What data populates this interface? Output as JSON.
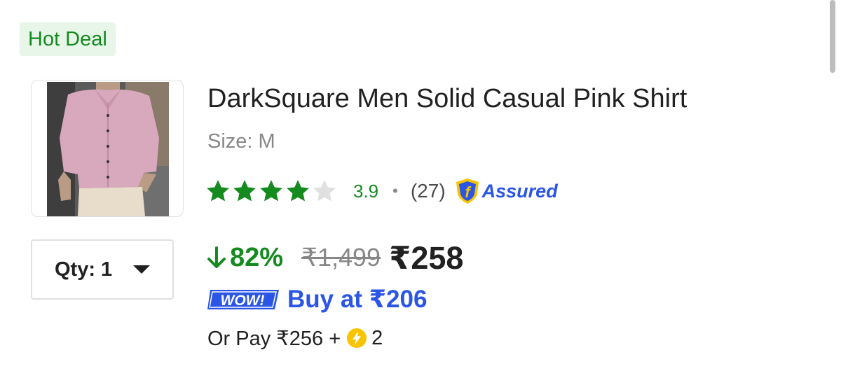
{
  "badge": {
    "label": "Hot Deal"
  },
  "product": {
    "title": "DarkSquare Men Solid Casual Pink Shirt",
    "size": "Size: M",
    "image_alt": "Pink shirt model photo"
  },
  "quantity": {
    "label": "Qty: 1"
  },
  "rating": {
    "value": "3.9",
    "separator": "•",
    "reviews": "(27)",
    "stars_filled": 4,
    "stars_total": 5,
    "assured_label": "Assured"
  },
  "pricing": {
    "discount": "82%",
    "mrp": "₹1,499",
    "price": "₹258"
  },
  "wow": {
    "badge_text": "WOW!",
    "label": "Buy at ₹206"
  },
  "pay": {
    "prefix": "Or Pay ₹256 +",
    "coins": "2"
  },
  "colors": {
    "green": "#148a1f",
    "blue": "#2a55e5",
    "badge_bg": "#e8f5e9",
    "star_empty": "#e0e0e0",
    "coin": "#f8c300"
  },
  "icons": {
    "discount": "arrow-down-icon",
    "quantity": "caret-down-icon",
    "assured": "shield-f-icon",
    "coin": "supercoin-icon"
  }
}
